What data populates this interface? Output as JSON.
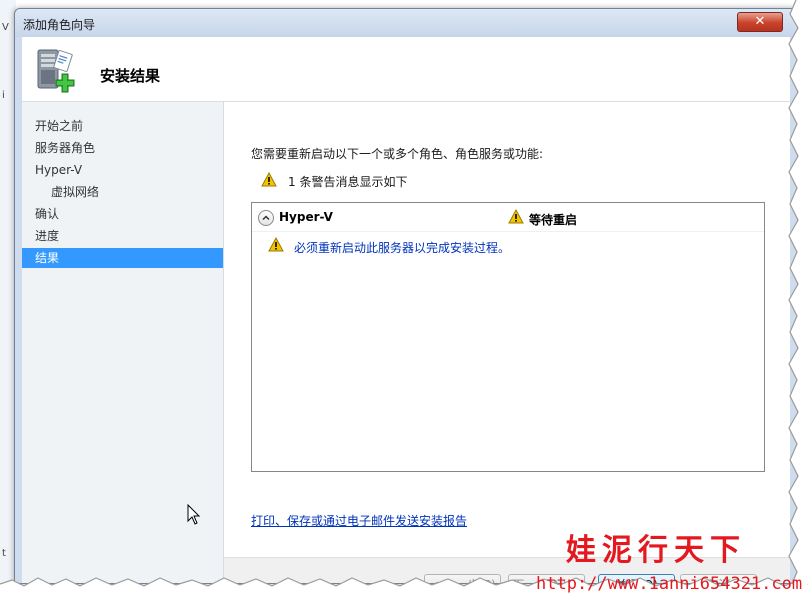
{
  "window": {
    "title": "添加角色向导",
    "close_glyph": "✕"
  },
  "header": {
    "title": "安装结果",
    "icon": "server-add-icon"
  },
  "nav": {
    "items": [
      {
        "label": "开始之前",
        "selected": false,
        "sub": false
      },
      {
        "label": "服务器角色",
        "selected": false,
        "sub": false
      },
      {
        "label": "Hyper-V",
        "selected": false,
        "sub": false
      },
      {
        "label": "虚拟网络",
        "selected": false,
        "sub": true
      },
      {
        "label": "确认",
        "selected": false,
        "sub": false
      },
      {
        "label": "进度",
        "selected": false,
        "sub": false
      },
      {
        "label": "结果",
        "selected": true,
        "sub": false
      }
    ]
  },
  "main": {
    "intro": "您需要重新启动以下一个或多个角色、角色服务或功能:",
    "warning_summary": "1 条警告消息显示如下",
    "results": {
      "role_name": "Hyper-V",
      "status": "等待重启",
      "message": "必须重新启动此服务器以完成安装过程。"
    },
    "report_link": "打印、保存或通过电子邮件发送安装报告"
  },
  "footer": {
    "back_label": "< 上一步(P)",
    "next_label": "下一步(N) >",
    "close_label": "关闭(O)",
    "cancel_label": "取消"
  },
  "watermark": {
    "text": "娃泥行天下",
    "url": "http://www.1anni654321.com"
  },
  "left_edge_fragments": [
    "V",
    "i",
    "t"
  ],
  "colors": {
    "selected_nav": "#3399ff",
    "link": "#0033bb",
    "warning": "#f5c400",
    "watermark": "#e3191f",
    "close_button": "#c7432c"
  }
}
